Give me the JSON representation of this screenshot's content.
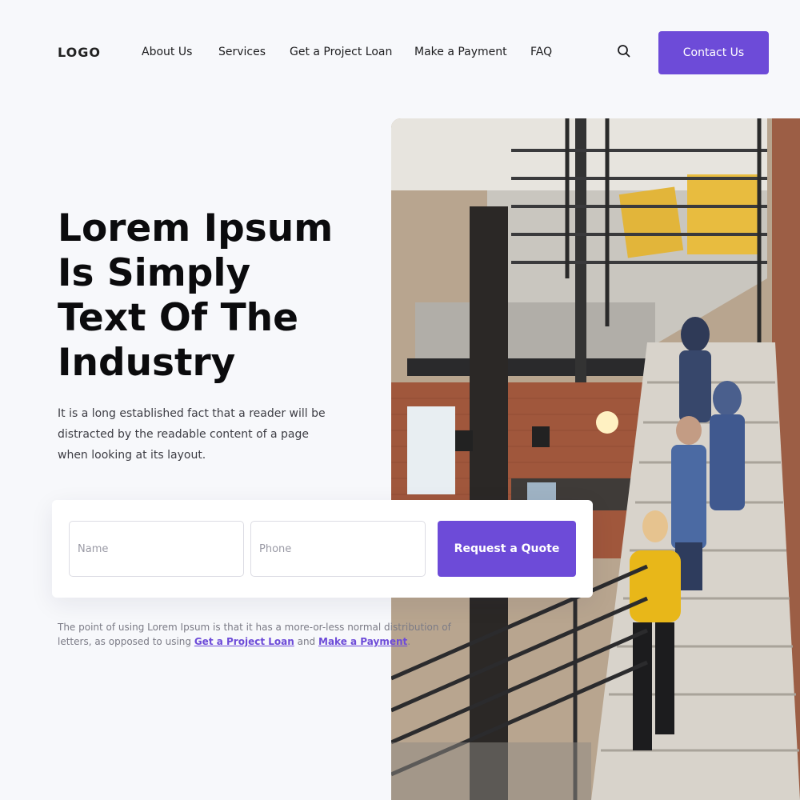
{
  "header": {
    "logo": "LOGO",
    "nav": [
      "About Us",
      "Services",
      "Get a Project Loan",
      "Make a Payment",
      "FAQ"
    ],
    "search_icon": "search-icon",
    "contact_label": "Contact Us"
  },
  "hero": {
    "title_lines": [
      "Lorem Ipsum",
      "Is Simply",
      "Text Of The",
      "Industry"
    ],
    "description": "It is a long established fact that a reader will be distracted by the readable content of a page when looking at its layout."
  },
  "quote_form": {
    "name_placeholder": "Name",
    "phone_placeholder": "Phone",
    "submit_label": "Request a Quote"
  },
  "note": {
    "text_before": "The point of using Lorem Ipsum is that it has a more-or-less normal distribution of letters, as opposed to using ",
    "link1": "Get a Project Loan",
    "text_middle": " and ",
    "link2": "Make a Payment",
    "text_after": "."
  },
  "colors": {
    "accent": "#6d4bd8",
    "background": "#f7f8fb"
  },
  "hero_image": "office-staircase-photo"
}
